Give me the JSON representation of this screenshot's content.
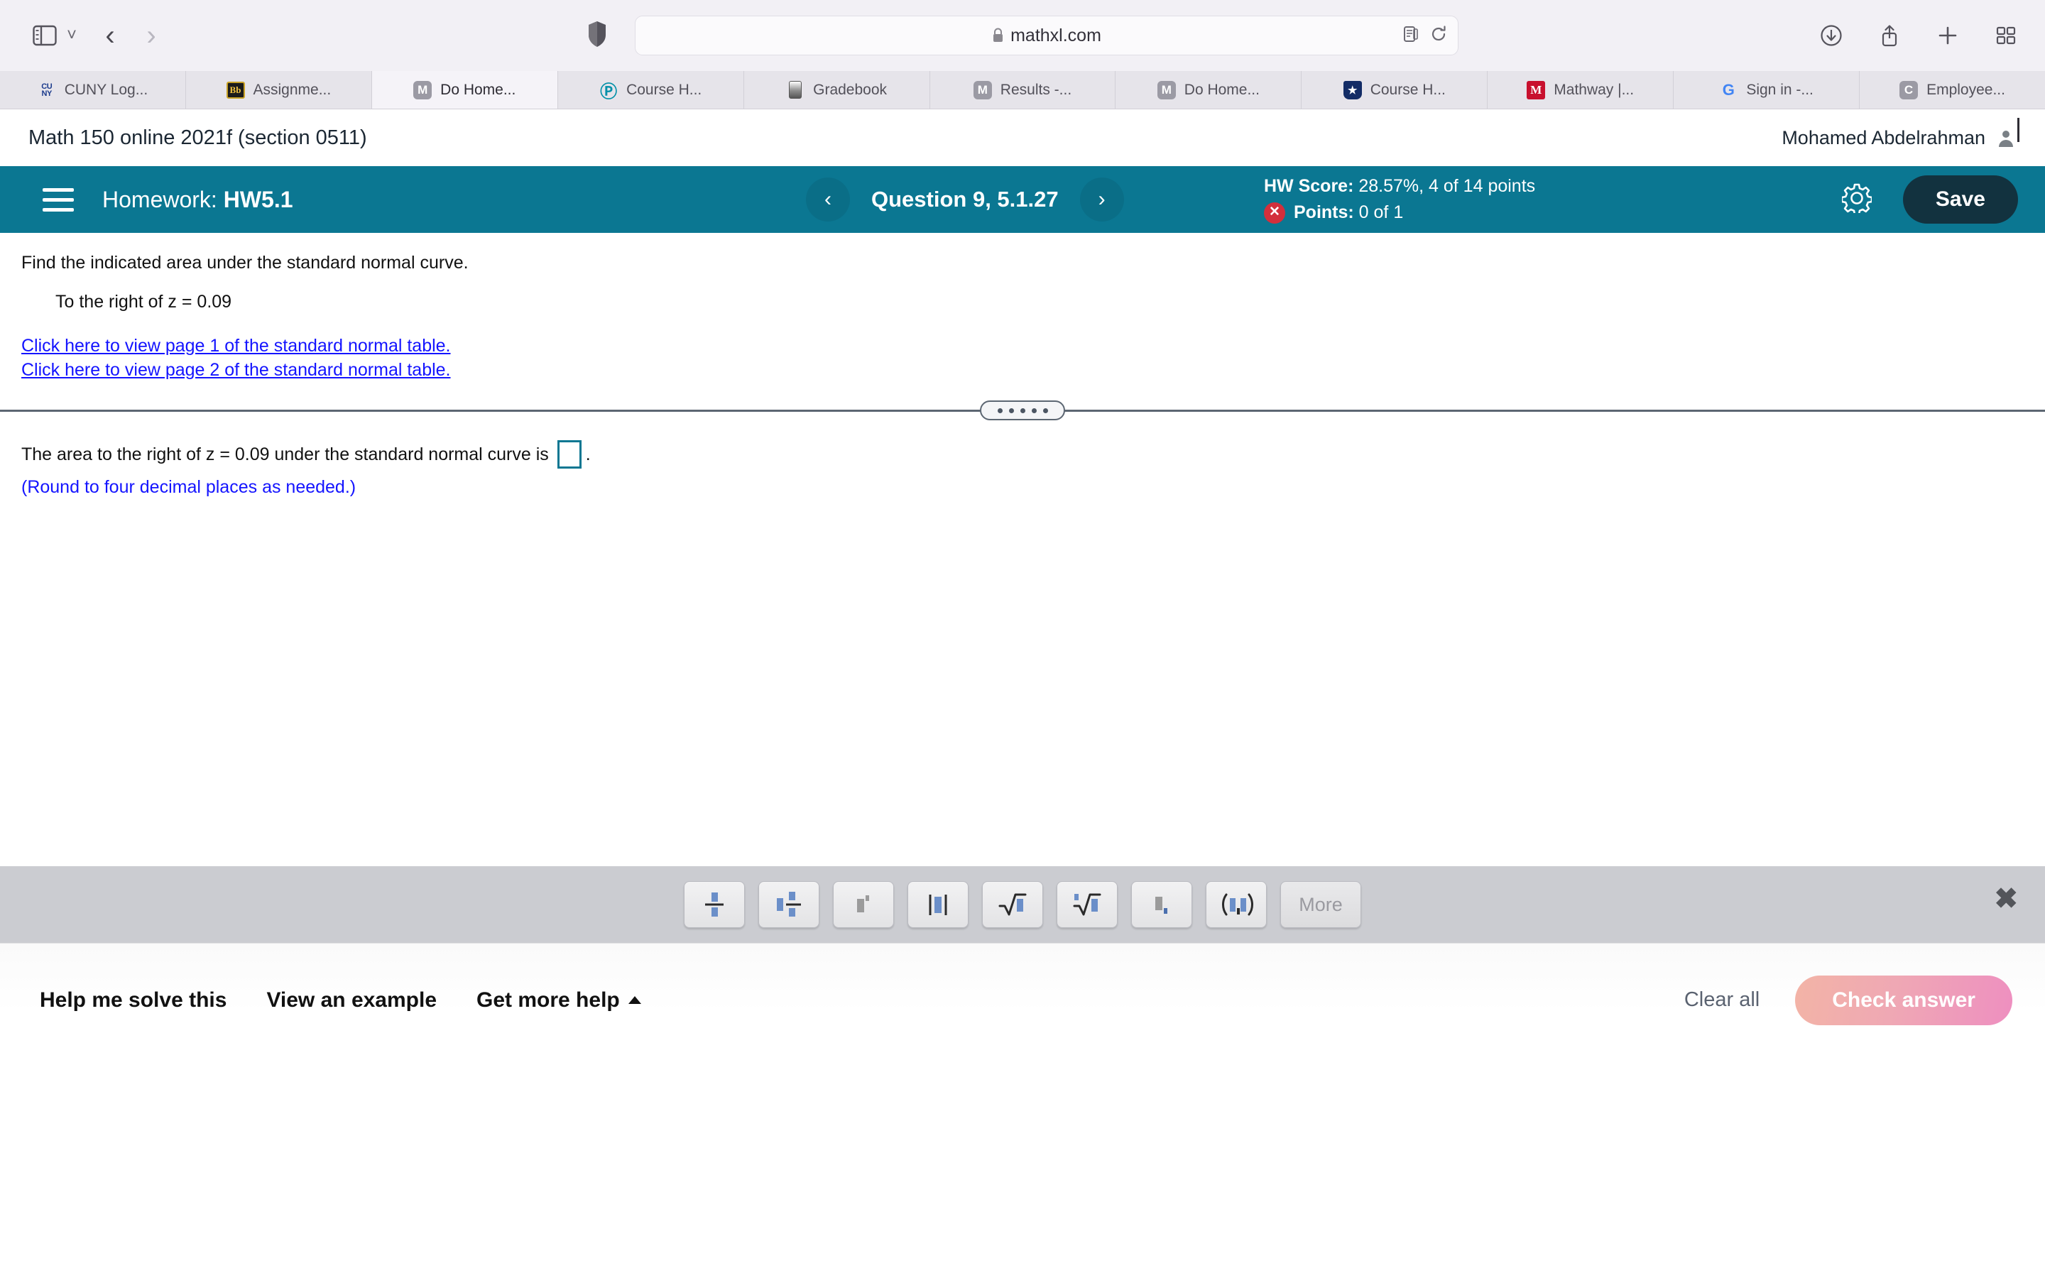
{
  "browser": {
    "url": "mathxl.com",
    "lock_icon": "lock-icon",
    "sidebar_icon": "sidebar-toggle-icon",
    "back_label": "‹",
    "forward_label": "›",
    "shield_icon": "privacy-shield-icon",
    "reader_icon": "reader-view-icon",
    "reload_icon": "reload-icon",
    "downloads_icon": "downloads-icon",
    "share_icon": "share-icon",
    "newtab_icon": "new-tab-icon",
    "tabs_overview_icon": "tab-overview-icon",
    "tabs": [
      {
        "label": "CUNY Log...",
        "favicon": "cuny-icon",
        "active": false
      },
      {
        "label": "Assignme...",
        "favicon": "blackboard-icon",
        "active": false
      },
      {
        "label": "Do Home...",
        "favicon": "mathxl-icon",
        "active": true
      },
      {
        "label": "Course H...",
        "favicon": "pearson-icon",
        "active": false
      },
      {
        "label": "Gradebook",
        "favicon": "gradebook-icon",
        "active": false
      },
      {
        "label": "Results -...",
        "favicon": "mathxl-icon",
        "active": false
      },
      {
        "label": "Do Home...",
        "favicon": "mathxl-icon",
        "active": false
      },
      {
        "label": "Course H...",
        "favicon": "star-shield-icon",
        "active": false
      },
      {
        "label": "Mathway |...",
        "favicon": "mathway-icon",
        "active": false
      },
      {
        "label": "Sign in -...",
        "favicon": "google-icon",
        "active": false
      },
      {
        "label": "Employee...",
        "favicon": "c-icon",
        "active": false
      }
    ]
  },
  "page": {
    "course_title": "Math 150 online 2021f (section 0511)",
    "user_name": "Mohamed Abdelrahman",
    "user_icon": "user-avatar-icon"
  },
  "toolbar": {
    "menu_icon": "hamburger-menu-icon",
    "homework_prefix": "Homework: ",
    "homework_name": "HW5.1",
    "prev_icon": "‹",
    "next_icon": "›",
    "question_title": "Question 9, 5.1.27",
    "hw_score_label": "HW Score: ",
    "hw_score_value": "28.57%, 4 of 14 points",
    "points_label": "Points: ",
    "points_value": "0 of 1",
    "points_status_icon": "incorrect-x-icon",
    "settings_icon": "gear-icon",
    "save_label": "Save"
  },
  "question": {
    "prompt": "Find the indicated area under the standard normal curve.",
    "sub_prompt": "To the right of z = 0.09",
    "link_page1": "Click here to view page 1 of the standard normal table.",
    "link_page2": "Click here to view page 2 of the standard normal table.",
    "answer_prefix": "The area to the right of z = 0.09 under the standard normal curve is",
    "answer_suffix": ".",
    "answer_value": "",
    "round_note": "(Round to four decimal places as needed.)",
    "splitter_icon": "resize-handle-icon"
  },
  "math_palette": {
    "close_icon": "close-icon",
    "buttons": [
      {
        "name": "fraction-button",
        "icon": "fraction-icon"
      },
      {
        "name": "mixed-number-button",
        "icon": "mixed-number-icon"
      },
      {
        "name": "exponent-button",
        "icon": "exponent-icon"
      },
      {
        "name": "absolute-value-button",
        "icon": "absolute-value-icon"
      },
      {
        "name": "square-root-button",
        "icon": "square-root-icon"
      },
      {
        "name": "nth-root-button",
        "icon": "nth-root-icon"
      },
      {
        "name": "subscript-button",
        "icon": "subscript-icon"
      },
      {
        "name": "ordered-pair-button",
        "icon": "ordered-pair-icon"
      }
    ],
    "more_label": "More"
  },
  "bottom": {
    "help_solve": "Help me solve this",
    "view_example": "View an example",
    "get_more_help": "Get more help",
    "get_more_help_icon": "caret-up-icon",
    "clear_all": "Clear all",
    "check_answer": "Check answer"
  },
  "colors": {
    "teal": "#0b7792",
    "save_navy": "#12323f",
    "link_blue": "#1414ff",
    "error_red": "#d32f3c"
  }
}
